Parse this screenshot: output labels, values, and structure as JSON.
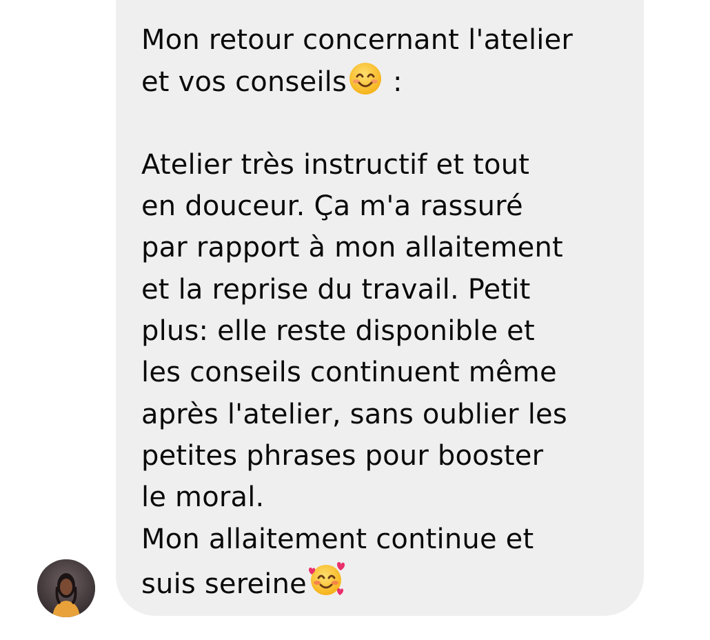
{
  "message": {
    "sender": "incoming",
    "lines": {
      "l1": "Mon retour concernant l'atelier",
      "l2_text": "et vos conseils",
      "l2_emoji": "smiling-face-icon",
      "l2_suffix": " :",
      "l3": "Atelier très instructif et tout",
      "l4": "en douceur. Ça m'a rassuré",
      "l5": "par rapport à mon allaitement",
      "l6": "et la reprise du travail. Petit",
      "l7": "plus: elle reste disponible et",
      "l8": "les conseils continuent même",
      "l9": "après l'atelier, sans oublier les",
      "l10": "petites phrases pour booster",
      "l11": "le moral.",
      "l12": "Mon allaitement continue et",
      "l13_text": "suis sereine",
      "l13_emoji": "smiling-face-with-hearts-icon"
    }
  },
  "colors": {
    "bubble_background": "#efefef",
    "text": "#0a0a0a",
    "page_background": "#ffffff"
  }
}
